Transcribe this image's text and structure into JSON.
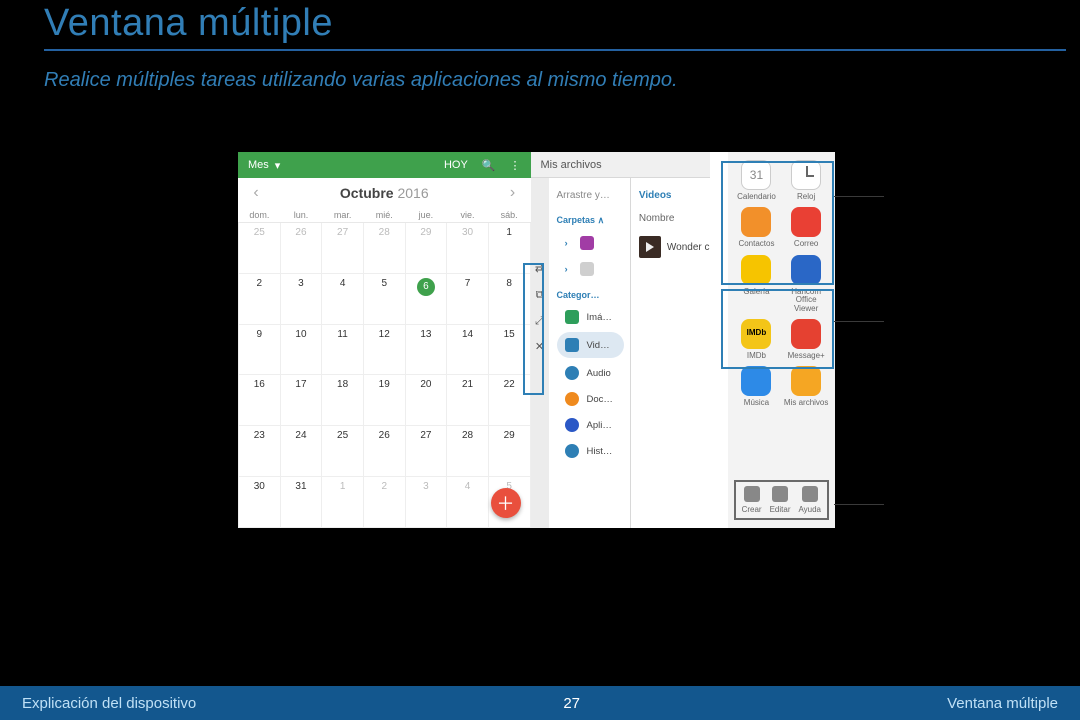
{
  "page": {
    "title": "Ventana múltiple",
    "subtitle": "Realice múltiples tareas utilizando varias aplicaciones al mismo tiempo."
  },
  "calendar": {
    "view_label": "Mes",
    "today_label": "HOY",
    "month": "Octubre",
    "year": "2016",
    "dow": [
      "dom.",
      "lun.",
      "mar.",
      "mié.",
      "jue.",
      "vie.",
      "sáb."
    ],
    "leading_out": [
      "25",
      "26",
      "27",
      "28",
      "29",
      "30"
    ],
    "days": [
      "1",
      "2",
      "3",
      "4",
      "5",
      "6",
      "7",
      "8",
      "9",
      "10",
      "11",
      "12",
      "13",
      "14",
      "15",
      "16",
      "17",
      "18",
      "19",
      "20",
      "21",
      "22",
      "23",
      "24",
      "25",
      "26",
      "27",
      "28",
      "29",
      "30",
      "31"
    ],
    "trailing_out": [
      "1",
      "2",
      "3",
      "4",
      "5"
    ],
    "today": "6"
  },
  "files": {
    "header": "Mis archivos",
    "tab_left": "Arrastre y…",
    "tab_right": "Videos",
    "section_folders": "Carpetas",
    "section_categories": "Categor…",
    "cat_images": "Imá…",
    "cat_videos": "Vid…",
    "cat_audio": "Audio",
    "cat_docs": "Doc…",
    "cat_apps": "Apli…",
    "cat_history": "Hist…",
    "col_name": "Nombre",
    "video_name": "Wonder c"
  },
  "tray": {
    "apps": {
      "calendar": "Calendario",
      "clock": "Reloj",
      "contacts": "Contactos",
      "mail": "Correo",
      "gallery": "Galería",
      "office": "Hancom Office Viewer",
      "imdb": "IMDb",
      "message": "Message+",
      "music": "Música",
      "myfiles": "Mis archivos"
    },
    "actions": {
      "create": "Crear",
      "edit": "Editar",
      "help": "Ayuda"
    }
  },
  "footer": {
    "left": "Explicación del dispositivo",
    "center": "27",
    "right": "Ventana múltiple"
  }
}
